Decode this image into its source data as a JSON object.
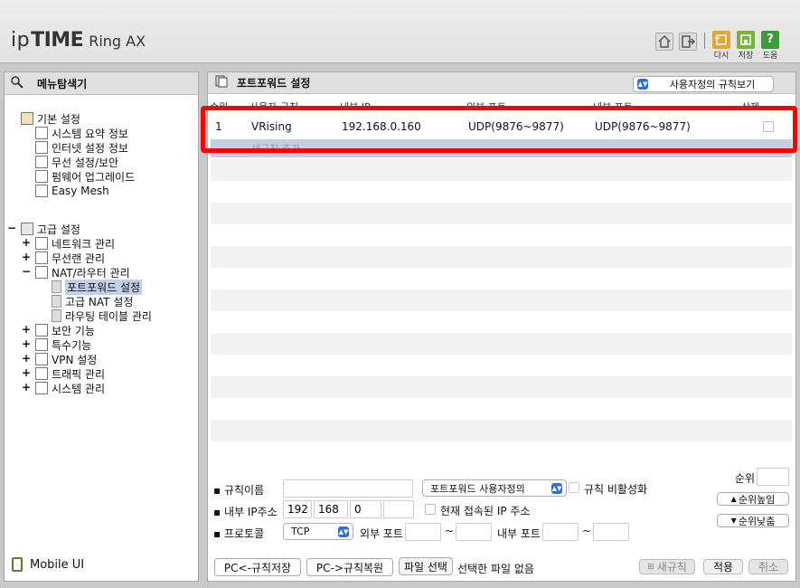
{
  "header": {
    "logo_ip": "ip",
    "logo_time": "TIME",
    "logo_model": "Ring AX",
    "icons": [
      {
        "name": "home-icon",
        "label": ""
      },
      {
        "name": "logout-icon",
        "label": ""
      },
      {
        "name": "refresh-icon",
        "label": "다시",
        "color": "#e2a633"
      },
      {
        "name": "save-icon",
        "label": "저장",
        "color": "#7bb23a"
      },
      {
        "name": "help-icon",
        "label": "도움",
        "color": "#3d9b3a"
      }
    ]
  },
  "sidebar": {
    "title": "메뉴탐색기",
    "basic_group": "기본 설정",
    "basic_items": [
      "시스템 요약 정보",
      "인터넷 설정 정보",
      "무선 설정/보안",
      "펌웨어 업그레이드",
      "Easy Mesh"
    ],
    "advanced_group": "고급 설정",
    "advanced_items": [
      {
        "label": "네트워크 관리",
        "sign": "+"
      },
      {
        "label": "무선랜 관리",
        "sign": "+"
      },
      {
        "label": "NAT/라우터 관리",
        "sign": "−"
      }
    ],
    "nat_subitems": [
      "포트포워드 설정",
      "고급 NAT 설정",
      "라우팅 테이블 관리"
    ],
    "more_items": [
      {
        "label": "보안 기능",
        "sign": "+"
      },
      {
        "label": "특수기능",
        "sign": "+"
      },
      {
        "label": "VPN 설정",
        "sign": "+"
      },
      {
        "label": "트래픽 관리",
        "sign": "+"
      },
      {
        "label": "시스템 관리",
        "sign": "+"
      }
    ],
    "mobile_ui": "Mobile UI"
  },
  "main": {
    "title": "포트포워드 설정",
    "view_select": "사용자정의 규칙보기",
    "columns": [
      "순위",
      "사용자 규칙",
      "내부 IP",
      "외부 포트",
      "내부 포트",
      "삭제"
    ],
    "rows": [
      {
        "rank": "1",
        "name": "VRising",
        "ip": "192.168.0.160",
        "ext": "UDP(9876~9877)",
        "int": "UDP(9876~9877)"
      }
    ],
    "hidden_row_text": "새규칙 추가",
    "form": {
      "rule_name_label": "규칙이름",
      "rule_type_select": "포트포워드 사용자정의",
      "disable_label": "규칙 비활성화",
      "rank_label": "순위",
      "ip_label": "내부 IP주소",
      "ip1": "192",
      "ip2": "168",
      "ip3": "0",
      "ip4": "",
      "current_ip_label": "현재 접속된 IP 주소",
      "rank_up": "순위높임",
      "rank_down": "순위낮춤",
      "protocol_label": "프로토콜",
      "protocol_value": "TCP",
      "ext_port_label": "외부 포트",
      "int_port_label": "내부 포트",
      "tilde": "~",
      "bullet": "▪"
    },
    "buttons": {
      "pc_save": "PC<-규칙저장",
      "pc_restore": "PC->규칙복원",
      "file_select": "파일 선택",
      "no_file": "선택한 파일 없음",
      "new_rule": "새규칙",
      "apply": "적용",
      "cancel": "취소"
    }
  }
}
